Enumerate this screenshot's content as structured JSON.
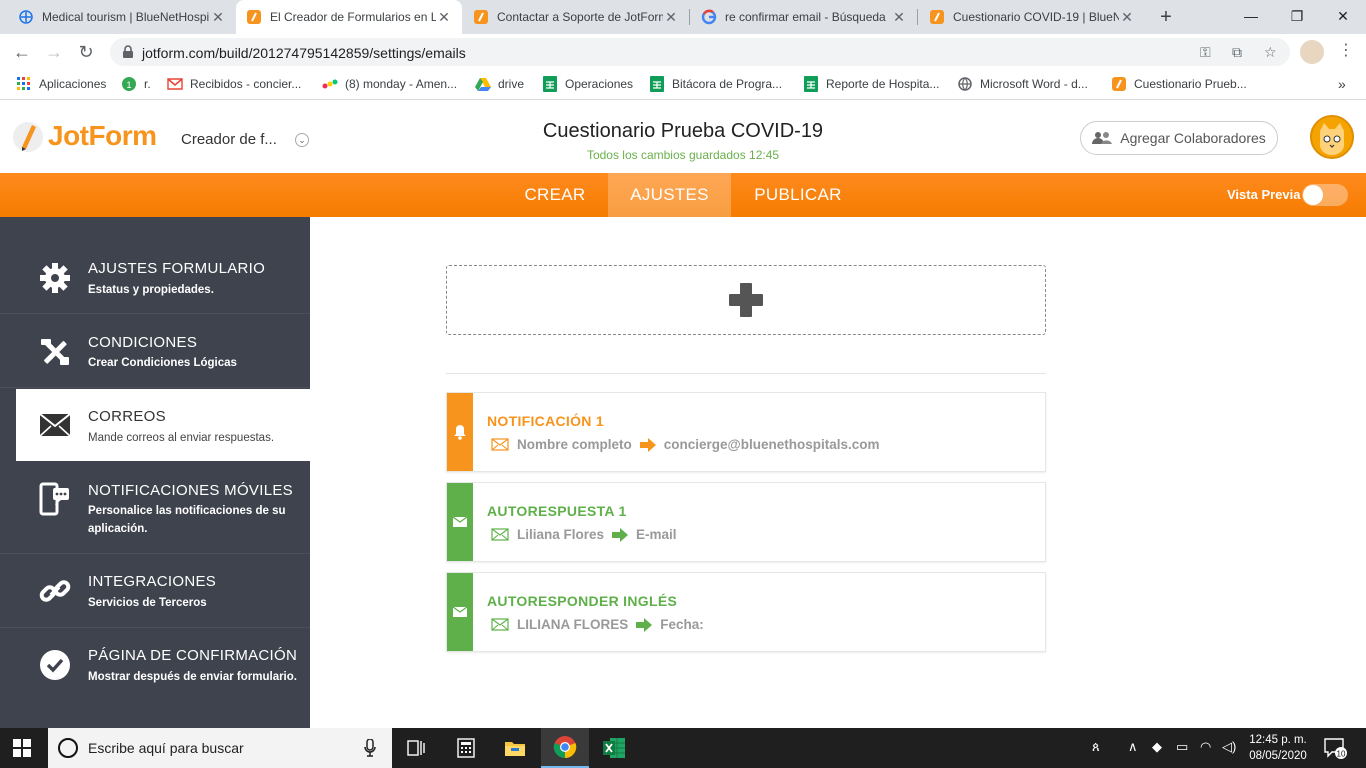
{
  "browser": {
    "tabs": [
      {
        "title": "Medical tourism | BlueNetHospi",
        "favicon": "globe-icon"
      },
      {
        "title": "El Creador de Formularios en Lí",
        "favicon": "jotform-icon",
        "active": true
      },
      {
        "title": "Contactar a Soporte de JotForm",
        "favicon": "jotform-icon"
      },
      {
        "title": "re confirmar email - Búsqueda",
        "favicon": "google-icon"
      },
      {
        "title": "Cuestionario COVID-19 | BlueN",
        "favicon": "jotform-icon"
      }
    ],
    "url": "jotform.com/build/201274795142859/settings/emails",
    "bookmarks": [
      "Aplicaciones",
      "r.",
      "Recibidos - concier...",
      "(8) monday - Amen...",
      "drive",
      "Operaciones",
      "Bitácora de Progra...",
      "Reporte de Hospita...",
      "Microsoft Word - d...",
      "Cuestionario Prueb..."
    ]
  },
  "app": {
    "logo_text": "JotForm",
    "creator_label": "Creador de f...",
    "form_title": "Cuestionario Prueba COVID-19",
    "save_status": "Todos los cambios guardados 12:45",
    "collab_label": "Agregar Colaboradores",
    "nav": {
      "tabs": [
        "CREAR",
        "AJUSTES",
        "PUBLICAR"
      ],
      "active": "AJUSTES",
      "preview_label": "Vista Previa"
    }
  },
  "sidebar": {
    "items": [
      {
        "title": "AJUSTES FORMULARIO",
        "sub": "Estatus y propiedades.",
        "icon": "gear-icon"
      },
      {
        "title": "CONDICIONES",
        "sub": "Crear Condiciones Lógicas",
        "icon": "tools-icon"
      },
      {
        "title": "CORREOS",
        "sub": "Mande correos al enviar respuestas.",
        "icon": "envelope-icon",
        "active": true
      },
      {
        "title": "NOTIFICACIONES MÓVILES",
        "sub": "Personalice las notificaciones de su aplicación.",
        "icon": "mobile-chat-icon"
      },
      {
        "title": "INTEGRACIONES",
        "sub": "Servicios de Terceros",
        "icon": "link-icon"
      },
      {
        "title": "PÁGINA DE CONFIRMACIÓN",
        "sub": "Mostrar después de enviar formulario.",
        "icon": "check-circle-icon"
      }
    ]
  },
  "emails": [
    {
      "type": "notification",
      "title": "NOTIFICACIÓN 1",
      "from": "Nombre completo",
      "to": "concierge@bluenethospitals.com",
      "color": "#f7941d"
    },
    {
      "type": "autoresponder",
      "title": "AUTORESPUESTA 1",
      "from": "Liliana Flores",
      "to": "E-mail",
      "color": "#5fb04a"
    },
    {
      "type": "autoresponder",
      "title": "AUTORESPONDER INGLÉS",
      "from": "LILIANA FLORES",
      "to": "Fecha:",
      "color": "#5fb04a"
    }
  ],
  "taskbar": {
    "search_placeholder": "Escribe aquí para buscar",
    "time": "12:45 p. m.",
    "date": "08/05/2020",
    "notification_count": "10"
  },
  "colors": {
    "brand_orange": "#f7941d",
    "sidebar_bg": "#3e434d",
    "autoresponder_green": "#5fb04a"
  }
}
